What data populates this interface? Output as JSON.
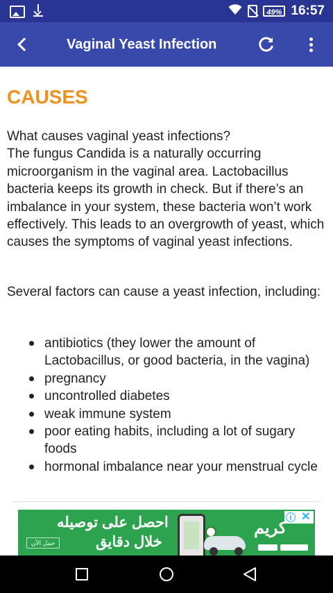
{
  "status_bar": {
    "battery": "49%",
    "time": "16:57"
  },
  "toolbar": {
    "title": "Vaginal Yeast Infection"
  },
  "content": {
    "heading": "CAUSES",
    "paragraph1_lines": [
      "What causes vaginal yeast infections?",
      "The fungus Candida is a naturally occurring microorganism in the vaginal area. Lactobacillus bacteria keeps its growth in check. But if there’s an imbalance in your system, these bacteria won’t work effectively. This leads to an overgrowth of yeast, which causes the symptoms of vaginal yeast infections."
    ],
    "paragraph2": "Several factors can cause a yeast infection, including:",
    "causes": [
      "antibiotics (they lower the amount of Lactobacillus, or good bacteria, in the vagina)",
      "pregnancy",
      "uncontrolled diabetes",
      "weak immune system",
      "poor eating habits, including a lot of sugary foods",
      "hormonal imbalance near your menstrual cycle"
    ]
  },
  "ad": {
    "headline": "احصل على توصيله",
    "subline": "خلال دقايق",
    "button": "حمل الآن",
    "brand": "كريم",
    "close": "✕",
    "info": "i"
  },
  "colors": {
    "status_bar": "#283593",
    "toolbar": "#3949ab",
    "heading": "#f0901e",
    "ad_background": "#2ea34f"
  }
}
